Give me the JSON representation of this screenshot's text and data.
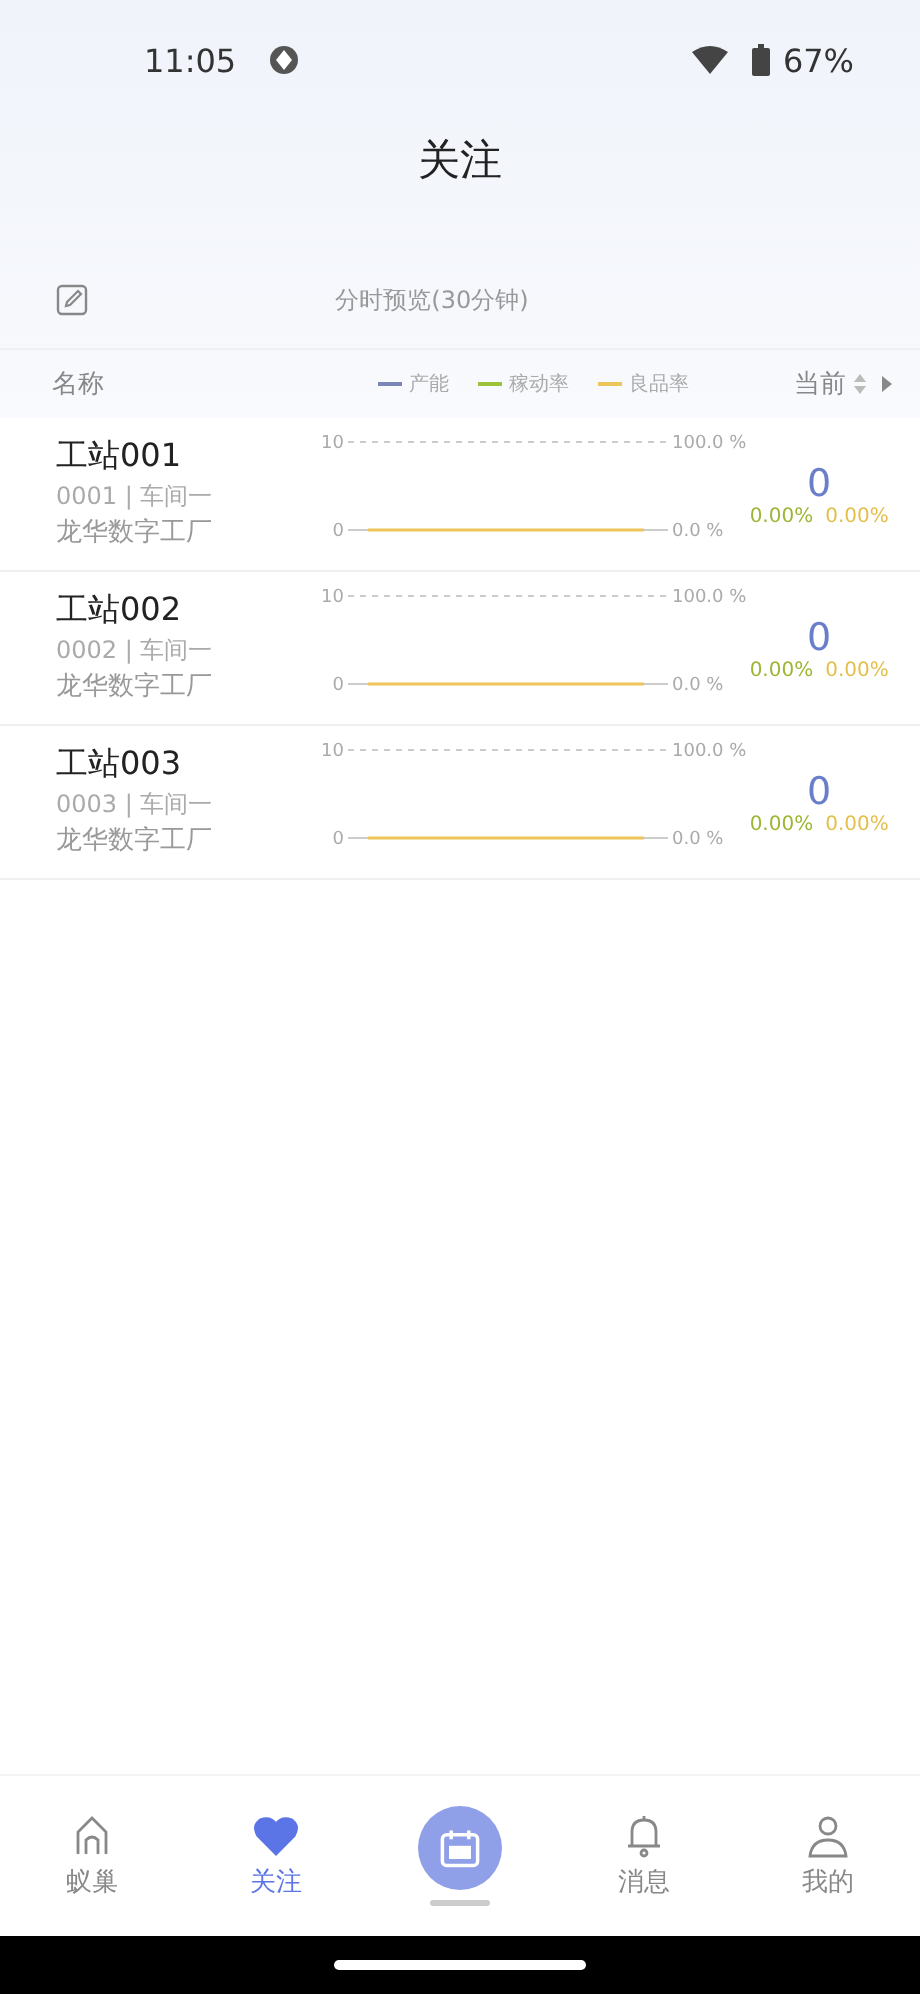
{
  "status_bar": {
    "time": "11:05",
    "battery": "67%"
  },
  "title": "关注",
  "toolbar": {
    "caption": "分时预览(30分钟)"
  },
  "header": {
    "name_label": "名称",
    "current_label": "当前",
    "legend": [
      {
        "label": "产能",
        "color": "#7b86b8"
      },
      {
        "label": "稼动率",
        "color": "#9cc13a"
      },
      {
        "label": "良品率",
        "color": "#eec55a"
      }
    ]
  },
  "rows": [
    {
      "name": "工站001",
      "code": "0001 | 车间一",
      "factory": "龙华数字工厂",
      "left_ticks": [
        "10",
        "0"
      ],
      "right_ticks": [
        "100.0 %",
        "0.0 %"
      ],
      "current": "0",
      "rate_a": "0.00%",
      "rate_b": "0.00%"
    },
    {
      "name": "工站002",
      "code": "0002 | 车间一",
      "factory": "龙华数字工厂",
      "left_ticks": [
        "10",
        "0"
      ],
      "right_ticks": [
        "100.0 %",
        "0.0 %"
      ],
      "current": "0",
      "rate_a": "0.00%",
      "rate_b": "0.00%"
    },
    {
      "name": "工站003",
      "code": "0003 | 车间一",
      "factory": "龙华数字工厂",
      "left_ticks": [
        "10",
        "0"
      ],
      "right_ticks": [
        "100.0 %",
        "0.0 %"
      ],
      "current": "0",
      "rate_a": "0.00%",
      "rate_b": "0.00%"
    }
  ],
  "nav": [
    {
      "kind": "home",
      "label": "蚁巢",
      "selected": false
    },
    {
      "kind": "heart",
      "label": "关注",
      "selected": true
    },
    {
      "kind": "center",
      "selected": false
    },
    {
      "kind": "bell",
      "label": "消息",
      "selected": false
    },
    {
      "kind": "person",
      "label": "我的",
      "selected": false
    }
  ]
}
